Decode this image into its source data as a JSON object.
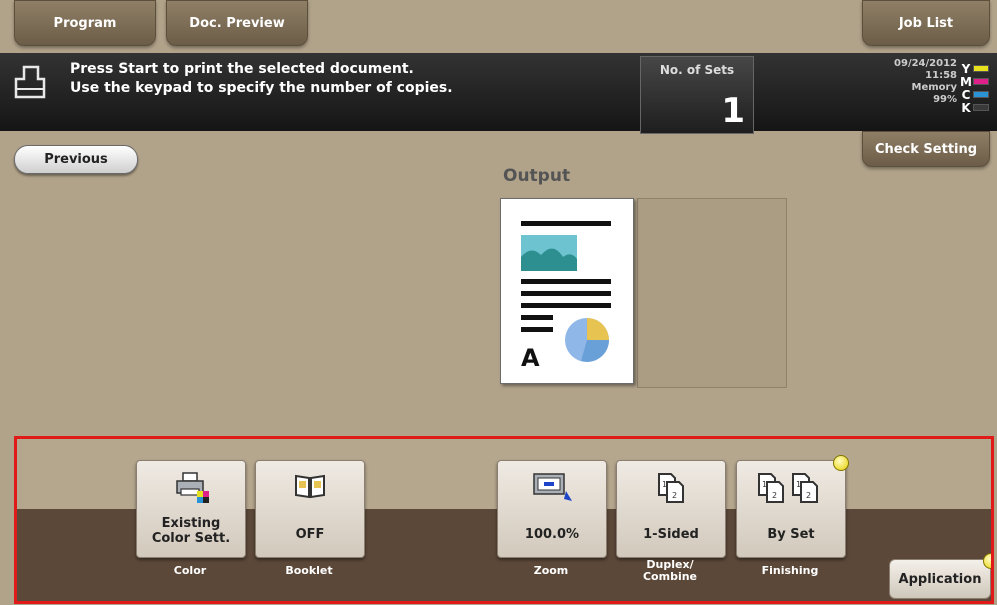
{
  "tabs": {
    "program": "Program",
    "doc_preview": "Doc. Preview",
    "job_list": "Job List"
  },
  "message": {
    "line1": "Press Start to print the selected document.",
    "line2": "Use the keypad to specify the number of copies."
  },
  "sets": {
    "label": "No. of Sets",
    "value": "1"
  },
  "status": {
    "date": "09/24/2012",
    "time": "11:58",
    "memory_label": "Memory",
    "memory_value": "99%"
  },
  "toner": [
    {
      "letter": "Y",
      "color": "#e8e21e"
    },
    {
      "letter": "M",
      "color": "#e0208a"
    },
    {
      "letter": "C",
      "color": "#2a93d6"
    },
    {
      "letter": "K",
      "color": "#3a3a3a"
    }
  ],
  "buttons": {
    "previous": "Previous",
    "check_setting": "Check Setting",
    "application": "Application"
  },
  "output": {
    "label": "Output"
  },
  "functions": [
    {
      "value_line1": "Existing",
      "value_line2": "Color Sett.",
      "caption_line1": "Color",
      "caption_line2": "",
      "icon": "printer-color-icon"
    },
    {
      "value_line1": "OFF",
      "value_line2": "",
      "caption_line1": "Booklet",
      "caption_line2": "",
      "icon": "booklet-icon"
    },
    {
      "value_line1": "100.0%",
      "value_line2": "",
      "caption_line1": "Zoom",
      "caption_line2": "",
      "icon": "zoom-icon"
    },
    {
      "value_line1": "1-Sided",
      "value_line2": "",
      "caption_line1": "Duplex/",
      "caption_line2": "Combine",
      "icon": "duplex-icon"
    },
    {
      "value_line1": "By Set",
      "value_line2": "",
      "caption_line1": "Finishing",
      "caption_line2": "",
      "icon": "finishing-icon"
    }
  ]
}
